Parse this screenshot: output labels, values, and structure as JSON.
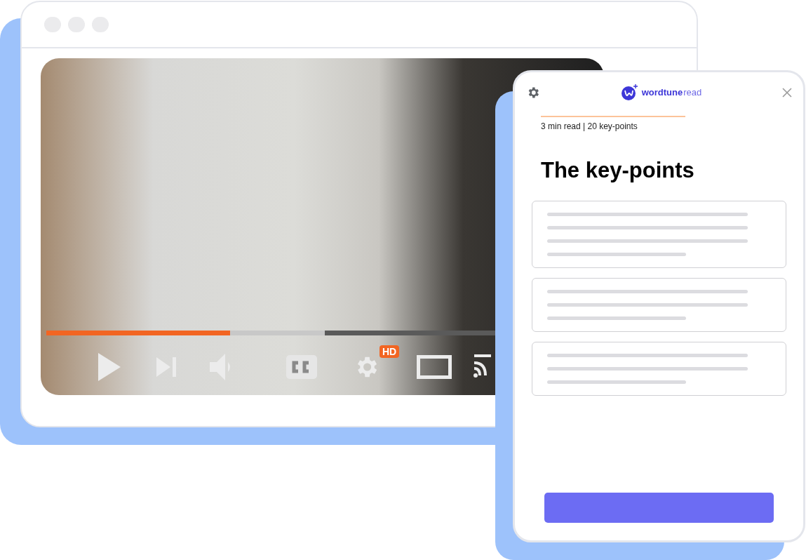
{
  "video": {
    "progress": {
      "level": 0.41,
      "buffered": {
        "level": 0.62
      }
    },
    "controls": [
      {
        "kind": "play"
      },
      {
        "kind": "next"
      },
      {
        "kind": "volume"
      },
      {
        "kind": "captions"
      },
      {
        "kind": "settings",
        "badge": "HD"
      },
      {
        "kind": "theater"
      },
      {
        "kind": "cast"
      }
    ]
  },
  "panel": {
    "logo": {
      "name": "wordtune",
      "suffix": "read"
    },
    "meta": "3 min read | 20 key-points",
    "title": "The key-points",
    "cards": [
      {
        "lines": [
          {
            "kind": "long"
          },
          {
            "kind": "long"
          },
          {
            "kind": "long"
          },
          {
            "kind": "short"
          }
        ]
      },
      {
        "lines": [
          {
            "kind": "long"
          },
          {
            "kind": "long"
          },
          {
            "kind": "short"
          }
        ]
      },
      {
        "lines": [
          {
            "kind": "long"
          },
          {
            "kind": "long"
          },
          {
            "kind": "short"
          }
        ]
      }
    ]
  }
}
